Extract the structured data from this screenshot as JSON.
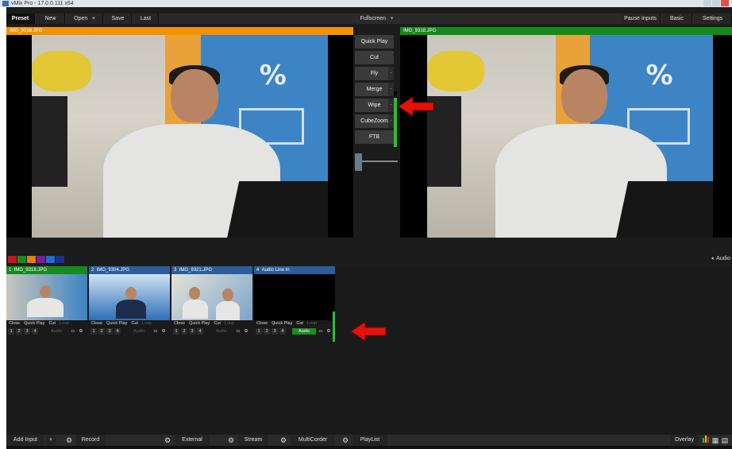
{
  "window": {
    "title": "vMix Pro - 17.0.0.111 x64"
  },
  "topbar": {
    "preset": "Preset",
    "new": "New",
    "open": "Open",
    "save": "Save",
    "last": "Last",
    "fullscreen": "Fullscreen",
    "pause_inputs": "Pause Inputs",
    "basic": "Basic",
    "settings": "Settings"
  },
  "preview": {
    "name": "IMG_9318.JPG"
  },
  "program": {
    "name": "IMG_9318.JPG"
  },
  "transitions": {
    "quick_play": "Quick Play",
    "cut": "Cut",
    "fly": "Fly",
    "merge": "Merge",
    "wipe": "Wipe",
    "cube_zoom": "CubeZoom",
    "ftb": "FTB",
    "dropdown_glyph": "-"
  },
  "tbar_meter_level": 0.88,
  "colors": {
    "preview": "#f39200",
    "program": "#138a1a",
    "input_active": "#178a1f",
    "input_header": "#2b5d9a",
    "arrow": "#e3120b",
    "palette": [
      "#c8141b",
      "#168a1f",
      "#e67e12",
      "#7a1ea1",
      "#1e6fd4",
      "#1d2f8e"
    ]
  },
  "audio_button": "Audio",
  "inputs": [
    {
      "number": "1",
      "name": "IMG_9318.JPG",
      "active": true,
      "audio_on": false
    },
    {
      "number": "2",
      "name": "IMG_9304.JPG",
      "active": false,
      "audio_on": false
    },
    {
      "number": "3",
      "name": "IMG_9321.JPG",
      "active": false,
      "audio_on": false
    },
    {
      "number": "4",
      "name": "Audio Line In",
      "active": false,
      "audio_on": true
    }
  ],
  "input_controls": {
    "close": "Close",
    "quick_play": "Quick Play",
    "cut": "Cut",
    "loop": "Loop",
    "audio": "Audio",
    "n1": "1",
    "n2": "2",
    "n3": "3",
    "n4": "4"
  },
  "input_meter_level": 0.95,
  "bottombar": {
    "add_input": "Add Input",
    "record": "Record",
    "external": "External",
    "stream": "Stream",
    "multicorder": "MultiCorder",
    "playlist": "PlayList",
    "overlay": "Overlay"
  },
  "icons": {
    "gear": "gear-icon",
    "monitor": "monitor-icon",
    "speaker": "speaker-icon",
    "grid": "grid-icon",
    "meter": "audio-meter-icon",
    "arrow": "red-arrow-icon"
  }
}
